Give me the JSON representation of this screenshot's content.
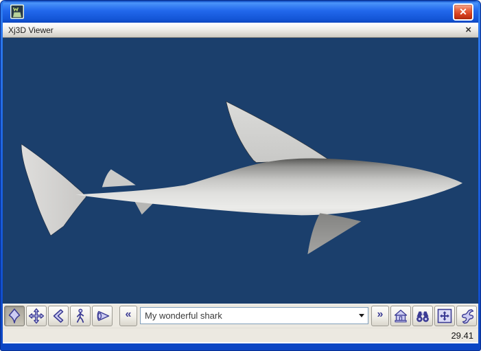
{
  "window": {
    "title": "",
    "close_glyph": "✕"
  },
  "inner_frame": {
    "title": "Xj3D Viewer",
    "close_glyph": "×"
  },
  "viewport": {
    "content": "3D shark model, side view facing right",
    "background_color": "#1b3f6c",
    "model_body_color": "#d9d9d7",
    "model_fin_color": "#d2d2d0",
    "model_pectoral_fin_color": "#8f8f8d"
  },
  "toolbar": {
    "nav_icons": [
      "fly-icon",
      "pan-icon",
      "tilt-icon",
      "walk-icon",
      "examine-icon"
    ],
    "previous_viewpoint_glyph": "«",
    "next_viewpoint_glyph": "»",
    "viewpoint_value": "My wonderful shark",
    "action_icons": [
      "home-icon",
      "seek-icon",
      "fit-world-icon",
      "scroll-icon"
    ]
  },
  "statusbar": {
    "fps": "29.41"
  },
  "colors": {
    "titlebar_blue": "#2268ec",
    "viewport_navy": "#1b3f6c",
    "toolbar_gray": "#ece9e1",
    "icon_purple": "#3c3c94",
    "icon_lavender": "#ccccf2",
    "close_button_red": "#d8411f"
  }
}
